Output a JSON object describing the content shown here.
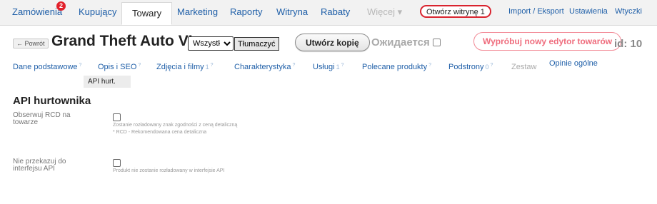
{
  "nav": {
    "tabs": [
      {
        "label": "Zamówienia",
        "badge": "2"
      },
      {
        "label": "Kupujący"
      },
      {
        "label": "Towary"
      },
      {
        "label": "Marketing"
      },
      {
        "label": "Raporty"
      },
      {
        "label": "Witryna"
      },
      {
        "label": "Rabaty"
      },
      {
        "label": "Więcej ▾"
      }
    ],
    "open_store": "Otwórz witrynę 1",
    "links": [
      "Import / Eksport",
      "Ustawienia",
      "Wtyczki"
    ]
  },
  "header": {
    "back": "← Powrót",
    "title": "Grand Theft Auto VI",
    "lang_selected": "Wszystkie",
    "translate": "Tłumaczyć",
    "copy": "Utwórz kopię",
    "status": "Ожидается",
    "new_editor": "Wypróbuj nowy edytor towarów",
    "id_label": "id: 10"
  },
  "subtabs": [
    {
      "label": "Dane podstawowe",
      "sup": "?"
    },
    {
      "label": "Opis i SEO",
      "sup": "?"
    },
    {
      "label": "Zdjęcia i filmy",
      "count": "1",
      "sup": "?"
    },
    {
      "label": "Charakterystyka",
      "sup": "?"
    },
    {
      "label": "Usługi",
      "count": "1",
      "sup": "?"
    },
    {
      "label": "Polecane produkty",
      "sup": "?"
    },
    {
      "label": "Podstrony",
      "count": "0",
      "sup": "?"
    },
    {
      "label": "Zestaw"
    },
    {
      "label": "Opinie ogólne"
    }
  ],
  "active_subtab": "API hurt.",
  "section": {
    "title": "API hurtownika",
    "fields": [
      {
        "label_line1": "Obserwuj RCD na",
        "label_line2": "towarze",
        "hint_line1": "Zostanie rozładowany znak zgodności z ceną detaliczną",
        "hint_line2": "* RCD - Rekomendowana cena detaliczna"
      },
      {
        "label_line1": "Nie przekazuj do",
        "label_line2": "interfejsu API",
        "hint_line1": "Produkt nie zostanie rozładowany w interfejsie API"
      }
    ]
  }
}
